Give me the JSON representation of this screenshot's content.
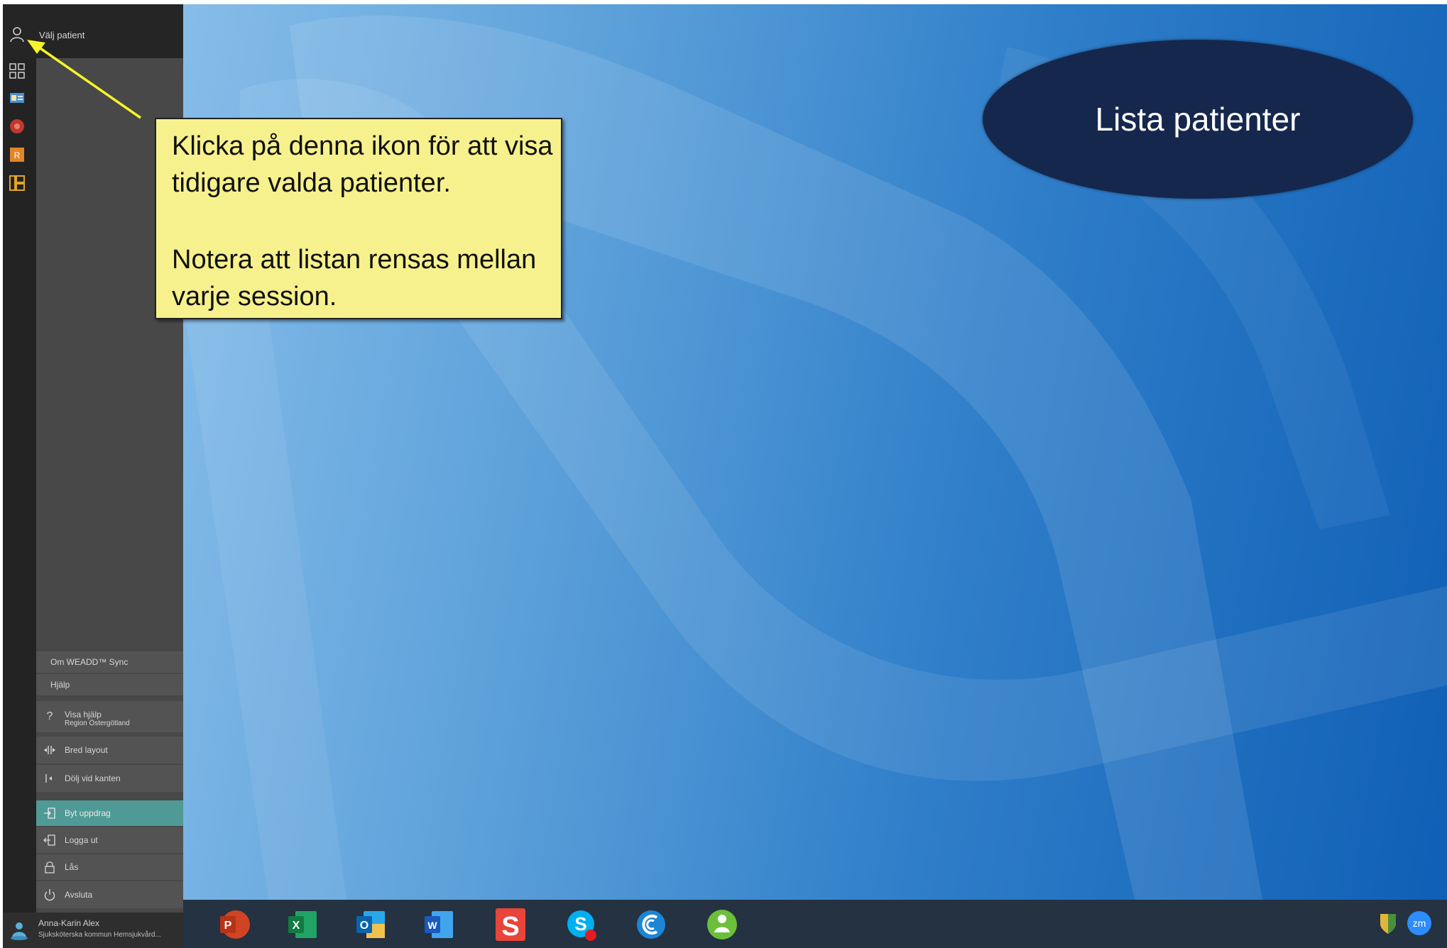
{
  "sidebar": {
    "patient_label": "Välj patient",
    "rail_icons": [
      "person-icon",
      "grid-icon",
      "id-card-icon",
      "red-app-icon",
      "orange-app-icon",
      "orange-grid-icon"
    ],
    "menu": {
      "about": "Om WEADD™ Sync",
      "help": "Hjälp",
      "show_help": "Visa hjälp",
      "show_help_sub": "Region Östergötland",
      "wide_layout": "Bred layout",
      "hide_edge": "Dölj vid kanten",
      "switch_task": "Byt uppdrag",
      "logout": "Logga ut",
      "lock": "Lås",
      "quit": "Avsluta"
    },
    "user": {
      "name": "Anna-Karin Alex",
      "role": "Sjuksköterska kommun Hemsjukvård..."
    }
  },
  "callout": {
    "line1": "Klicka på denna ikon för att visa tidigare valda patienter.",
    "line2": "Notera att listan rensas mellan varje session."
  },
  "title": "Lista patienter",
  "taskbar": {
    "apps": [
      "powerpoint-icon",
      "excel-icon",
      "outlook-icon",
      "word-icon",
      "s-app-icon",
      "skype-icon",
      "c-app-icon",
      "weadd-icon"
    ],
    "tray": [
      "shield-icon",
      "zoom-icon"
    ],
    "zoom_label": "zm"
  },
  "colors": {
    "callout_bg": "#f7f18d",
    "title_bg": "#15274d",
    "highlight": "#4f9a96",
    "arrow": "#f5f52a"
  }
}
